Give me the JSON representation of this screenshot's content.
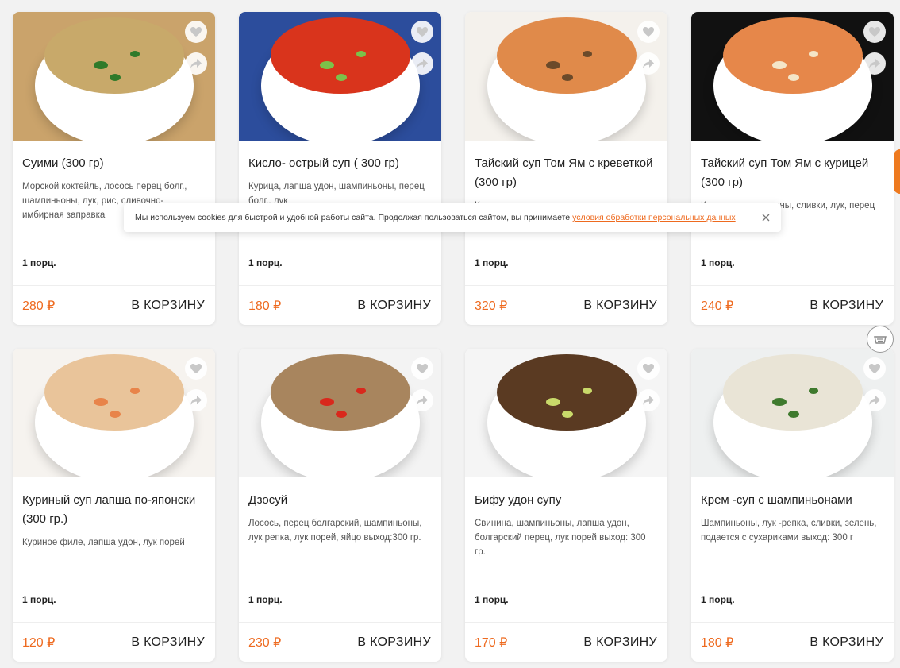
{
  "products": [
    {
      "title": "Суими (300 гр)",
      "desc": "Морской коктейль, лосось перец болг., шампиньоны, лук, рис, сливочно- имбирная заправка",
      "portion": "1 порц.",
      "price": "280 ₽",
      "cart_label": "В КОРЗИНУ",
      "bg": "#caa36b",
      "soup": "#c8a96a",
      "accent": "#2f7a2a"
    },
    {
      "title": "Кисло- острый суп ( 300 гр)",
      "desc": "Курица, лапша удон, шампиньоны, перец болг., лук",
      "portion": "1 порц.",
      "price": "180 ₽",
      "cart_label": "В КОРЗИНУ",
      "bg": "#2c4d9c",
      "soup": "#d9341c",
      "accent": "#7cc24a"
    },
    {
      "title": "Тайский суп Том Ям с креветкой (300 гр)",
      "desc": "Креветки, шампиньоны, сливки, лук, перец",
      "portion": "1 порц.",
      "price": "320 ₽",
      "cart_label": "В КОРЗИНУ",
      "bg": "#f4f1ec",
      "soup": "#e08a4a",
      "accent": "#6b4a2a"
    },
    {
      "title": "Тайский суп Том Ям с курицей (300 гр)",
      "desc": "Курица, шампиньоны, сливки, лук, перец",
      "portion": "1 порц.",
      "price": "240 ₽",
      "cart_label": "В КОРЗИНУ",
      "bg": "#111111",
      "soup": "#e6874a",
      "accent": "#f4e6c8"
    },
    {
      "title": "Куриный суп лапша по-японски (300 гр.)",
      "desc": "Куриное филе, лапша удон, лук порей",
      "portion": "1 порц.",
      "price": "120 ₽",
      "cart_label": "В КОРЗИНУ",
      "bg": "#f6f3ef",
      "soup": "#e9c49a",
      "accent": "#e8844a"
    },
    {
      "title": "Дзосуй",
      "desc": "Лосось, перец болгарский, шампиньоны, лук репка, лук порей, яйцо выход:300 гр.",
      "portion": "1 порц.",
      "price": "230 ₽",
      "cart_label": "В КОРЗИНУ",
      "bg": "#f3f3f3",
      "soup": "#a8855e",
      "accent": "#d9281c"
    },
    {
      "title": "Бифу удон супу",
      "desc": "Свинина, шампиньоны, лапша удон, болгарский перец, лук порей выход: 300 гр.",
      "portion": "1 порц.",
      "price": "170 ₽",
      "cart_label": "В КОРЗИНУ",
      "bg": "#f5f5f5",
      "soup": "#5a3a22",
      "accent": "#c9d96a"
    },
    {
      "title": "Крем -суп с шампиньонами",
      "desc": "Шампиньоны, лук -репка, сливки, зелень, подается с сухариками выход: 300 г",
      "portion": "1 порц.",
      "price": "180 ₽",
      "cart_label": "В КОРЗИНУ",
      "bg": "#eef0f0",
      "soup": "#e9e4d6",
      "accent": "#3f7a2e"
    }
  ],
  "cookie": {
    "text": "Мы используем cookies для быстрой и удобной работы сайта. Продолжая пользоваться сайтом, вы принимаете",
    "link": "условия обработки персональных данных"
  },
  "colors": {
    "accent": "#ee6a1f"
  },
  "icons": {
    "favorite": "heart-icon",
    "share": "share-icon",
    "close": "close-icon",
    "basket": "basket-icon"
  }
}
